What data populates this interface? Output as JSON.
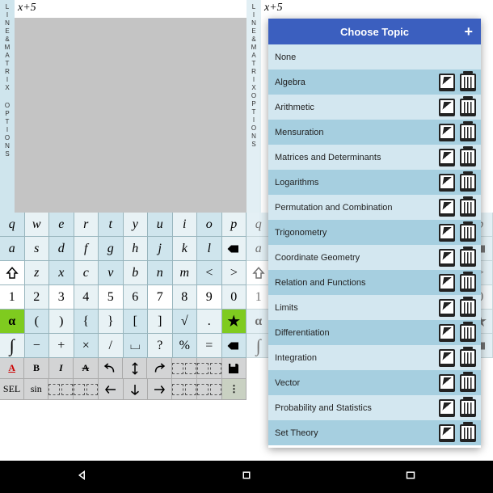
{
  "expression": "x+5",
  "sidebar": {
    "group1": [
      "L",
      "I",
      "N",
      "E",
      "&",
      "M",
      "A",
      "T",
      "R",
      "I",
      "X"
    ],
    "group2": [
      "O",
      "P",
      "T",
      "I",
      "O",
      "N",
      "S"
    ]
  },
  "keyboard": {
    "row1": [
      "q",
      "w",
      "e",
      "r",
      "t",
      "y",
      "u",
      "i",
      "o",
      "p"
    ],
    "row2": [
      "a",
      "s",
      "d",
      "f",
      "g",
      "h",
      "j",
      "k",
      "l",
      "⬅"
    ],
    "row3": [
      "⇧",
      "z",
      "x",
      "c",
      "v",
      "b",
      "n",
      "m",
      "<",
      ">"
    ],
    "row4": [
      "1",
      "2",
      "3",
      "4",
      "5",
      "6",
      "7",
      "8",
      "9",
      "0"
    ],
    "row5": [
      "α",
      "(",
      ")",
      "{",
      "}",
      "[",
      "]",
      "√",
      ".",
      "★"
    ],
    "row6": [
      "∫",
      "−",
      "+",
      "×",
      "/",
      "⌴",
      "?",
      "%",
      "=",
      "⬅"
    ],
    "tool1": [
      "A",
      "B",
      "I",
      "A̶",
      "↶",
      "↕",
      "↷",
      "□□",
      "□□",
      "💾"
    ],
    "tool2": [
      "SEL",
      "sin",
      "□□",
      "□□",
      "←",
      "↓",
      "→",
      "□□",
      "□□",
      "⋮"
    ]
  },
  "dialog": {
    "title": "Choose Topic",
    "add": "+",
    "topics": [
      {
        "label": "None",
        "actions": false
      },
      {
        "label": "Algebra",
        "actions": true
      },
      {
        "label": "Arithmetic",
        "actions": true
      },
      {
        "label": "Mensuration",
        "actions": true
      },
      {
        "label": "Matrices and Determinants",
        "actions": true
      },
      {
        "label": "Logarithms",
        "actions": true
      },
      {
        "label": "Permutation and Combination",
        "actions": true
      },
      {
        "label": "Trigonometry",
        "actions": true
      },
      {
        "label": "Coordinate Geometry",
        "actions": true
      },
      {
        "label": "Relation and Functions",
        "actions": true
      },
      {
        "label": "Limits",
        "actions": true
      },
      {
        "label": "Differentiation",
        "actions": true
      },
      {
        "label": "Integration",
        "actions": true
      },
      {
        "label": "Vector",
        "actions": true
      },
      {
        "label": "Probability and Statistics",
        "actions": true
      },
      {
        "label": "Set Theory",
        "actions": true
      }
    ]
  }
}
